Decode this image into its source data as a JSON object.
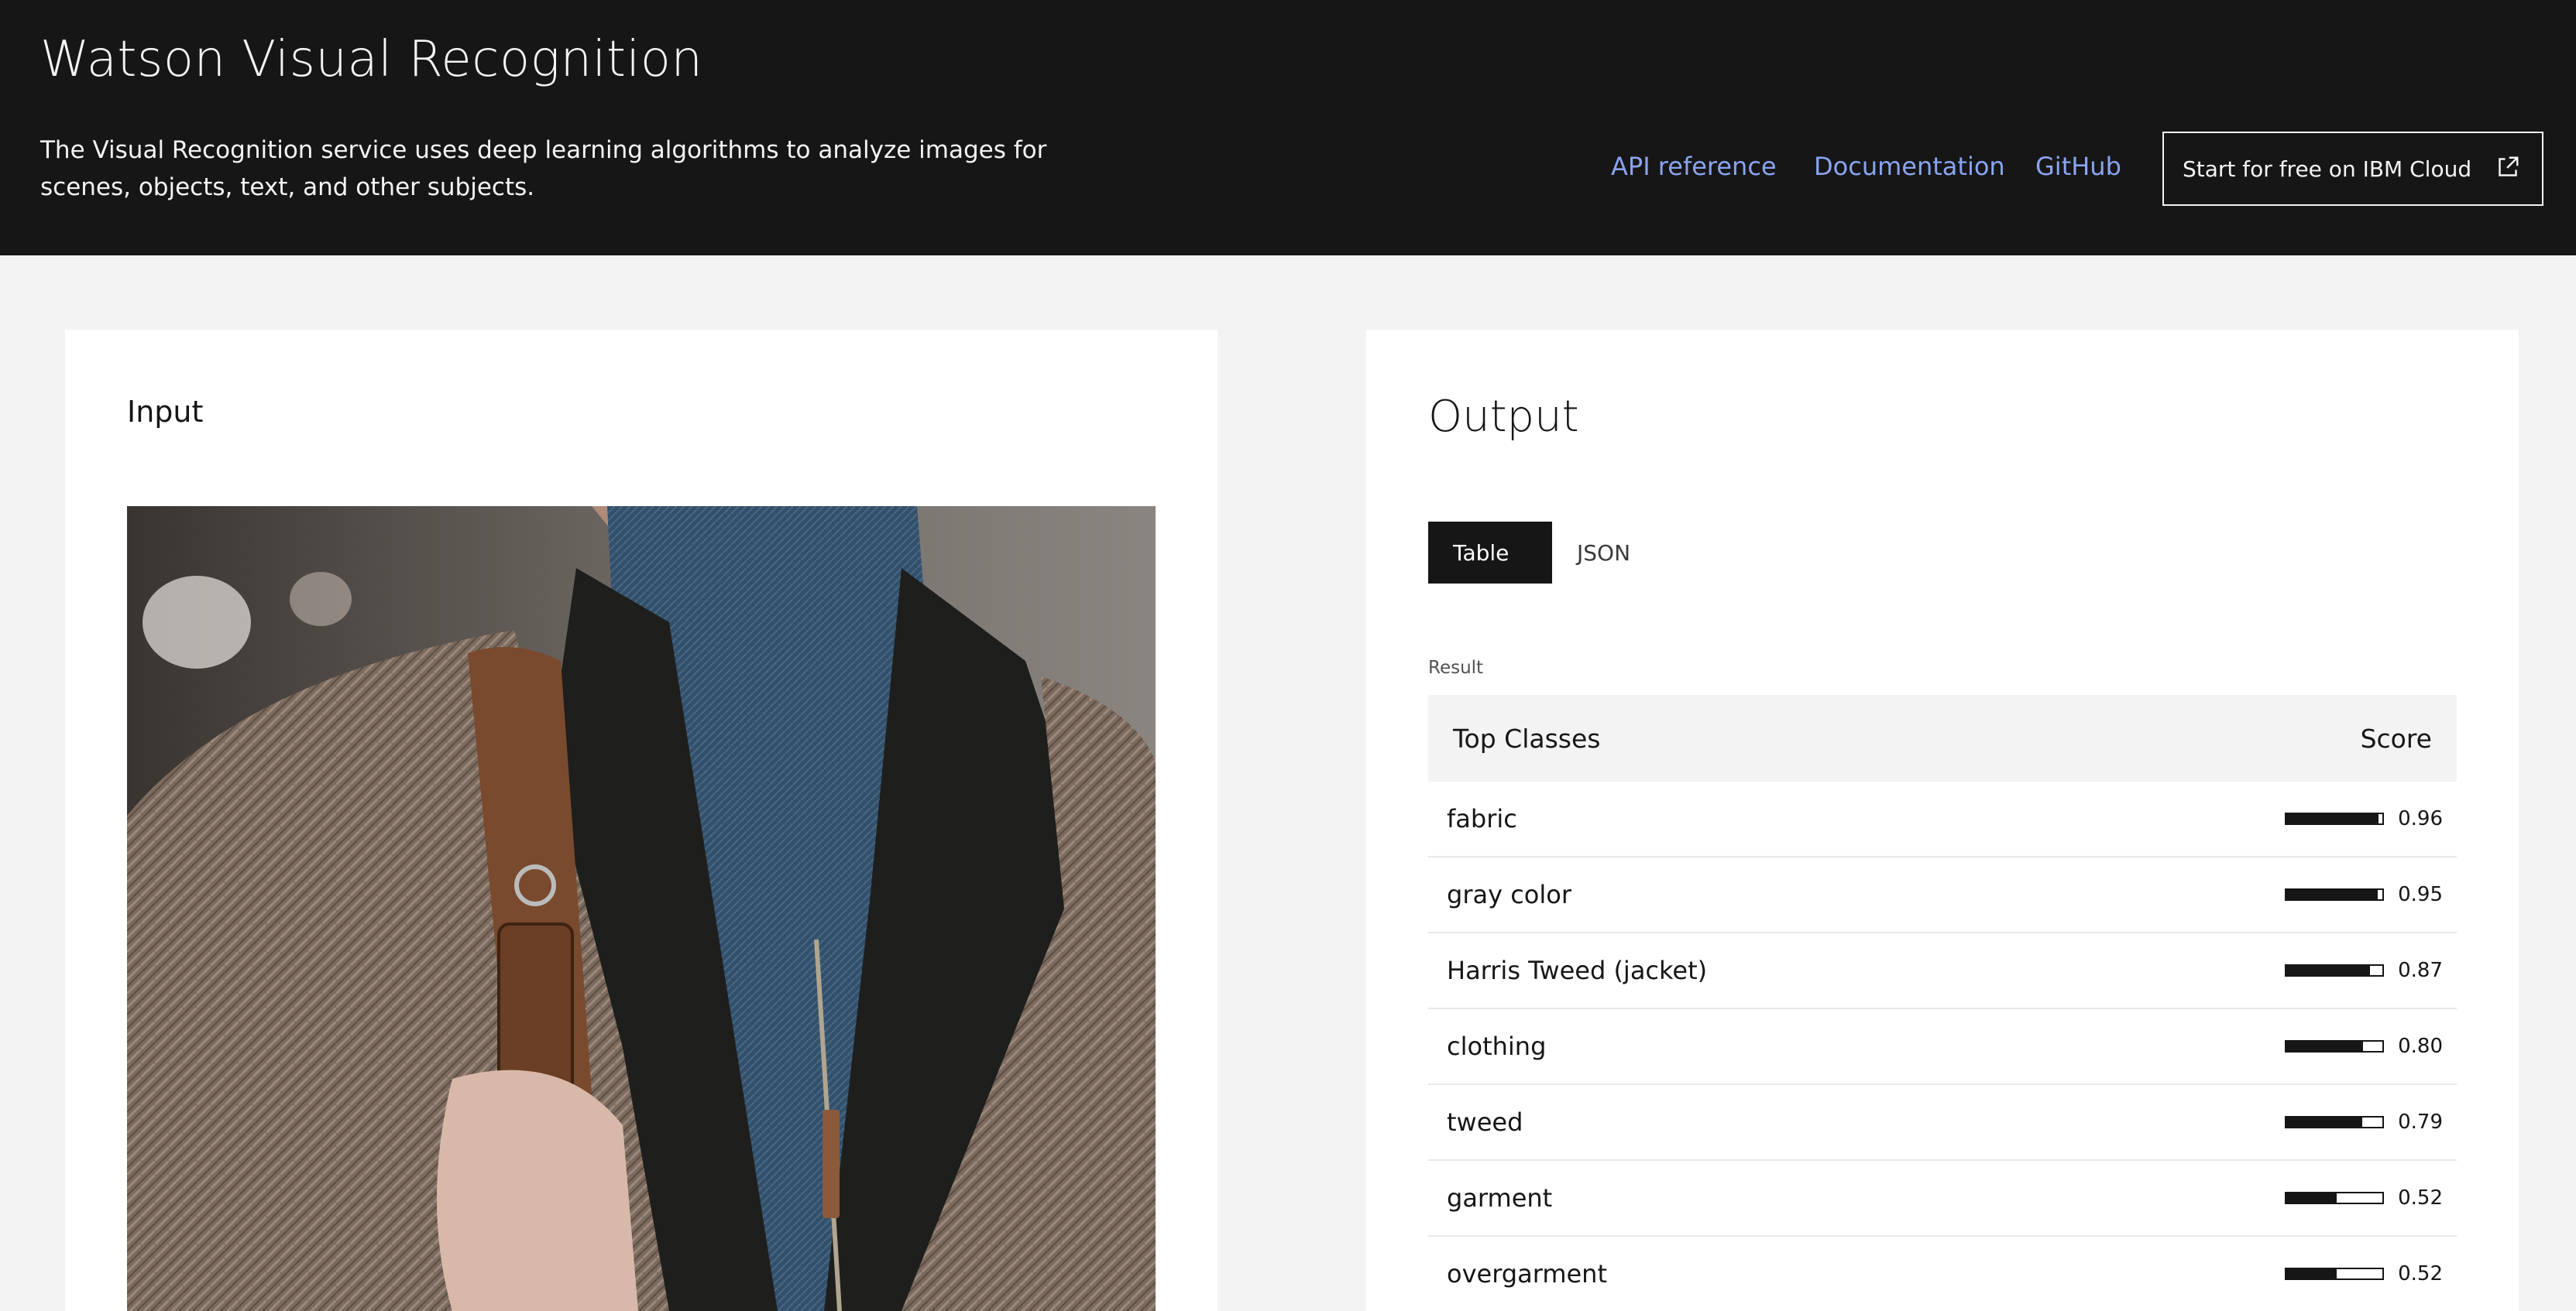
{
  "header": {
    "title": "Watson Visual Recognition",
    "description": "The Visual Recognition service uses deep learning algorithms to analyze images for scenes, objects, text, and other subjects.",
    "nav": [
      "API reference",
      "Documentation",
      "GitHub"
    ],
    "cta_label": "Start for free on IBM Cloud"
  },
  "input": {
    "label": "Input"
  },
  "output": {
    "label": "Output",
    "tabs": [
      "Table",
      "JSON"
    ],
    "active_tab": "Table",
    "result_caption": "Result",
    "columns": [
      "Top Classes",
      "Score"
    ],
    "rows": [
      {
        "class": "fabric",
        "score": "0.96",
        "value": 0.96
      },
      {
        "class": "gray color",
        "score": "0.95",
        "value": 0.95
      },
      {
        "class": "Harris Tweed (jacket)",
        "score": "0.87",
        "value": 0.87
      },
      {
        "class": "clothing",
        "score": "0.80",
        "value": 0.8
      },
      {
        "class": "tweed",
        "score": "0.79",
        "value": 0.79
      },
      {
        "class": "garment",
        "score": "0.52",
        "value": 0.52
      },
      {
        "class": "overgarment",
        "score": "0.52",
        "value": 0.52
      }
    ]
  },
  "colors": {
    "header_bg": "#161616",
    "link": "#8aa4ef",
    "page_bg": "#f3f3f3",
    "bar": "#161616"
  }
}
